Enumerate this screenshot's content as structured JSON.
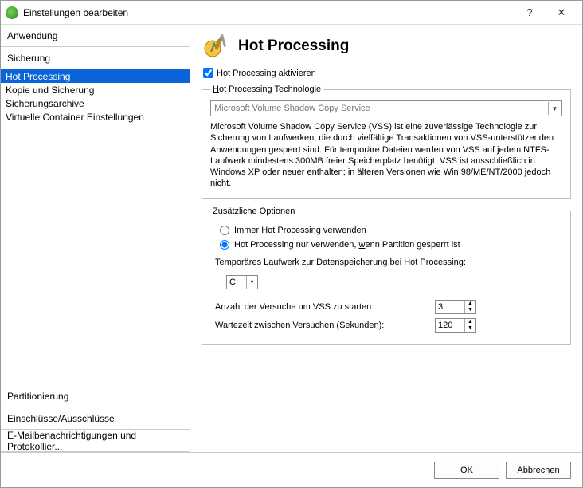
{
  "window": {
    "title": "Einstellungen bearbeiten"
  },
  "sidebar": {
    "sections": [
      {
        "label": "Anwendung",
        "items": []
      },
      {
        "label": "Sicherung",
        "items": [
          {
            "label": "Hot Processing",
            "selected": true
          },
          {
            "label": "Kopie und Sicherung"
          },
          {
            "label": "Sicherungsarchive"
          },
          {
            "label": "Virtuelle Container Einstellungen"
          }
        ]
      },
      {
        "label": "Partitionierung",
        "items": []
      },
      {
        "label": "Einschlüsse/Ausschlüsse",
        "items": []
      },
      {
        "label": "E-Mailbenachrichtigungen und Protokollier...",
        "items": []
      }
    ]
  },
  "page": {
    "title": "Hot Processing",
    "activate_label": "Hot Processing aktivieren",
    "activate_checked": true,
    "tech_group": {
      "legend": "Hot Processing Technologie",
      "dropdown_value": "Microsoft Volume Shadow Copy Service",
      "description": "Microsoft Volume Shadow Copy Service (VSS) ist eine zuverlässige Technologie zur Sicherung von Laufwerken, die durch vielfältige Transaktionen von VSS-unterstützenden Anwendungen gesperrt sind. Für temporäre Dateien werden von VSS auf jedem NTFS-Laufwerk mindestens 300MB freier Speicherplatz benötigt. VSS ist ausschließlich in Windows XP oder neuer enthalten; in älteren Versionen wie Win 98/ME/NT/2000 jedoch nicht."
    },
    "extra_group": {
      "legend": "Zusätzliche Optionen",
      "radio_always": "Immer Hot Processing verwenden",
      "radio_locked": "Hot Processing nur verwenden, wenn Partition gesperrt ist",
      "radio_selected": "locked",
      "temp_label": "Temporäres Laufwerk zur Datenspeicherung bei Hot Processing:",
      "temp_value": "C:",
      "attempts_label": "Anzahl der Versuche um VSS zu starten:",
      "attempts_value": "3",
      "wait_label": "Wartezeit zwischen Versuchen (Sekunden):",
      "wait_value": "120"
    }
  },
  "footer": {
    "ok": "OK",
    "cancel": "Abbrechen"
  }
}
